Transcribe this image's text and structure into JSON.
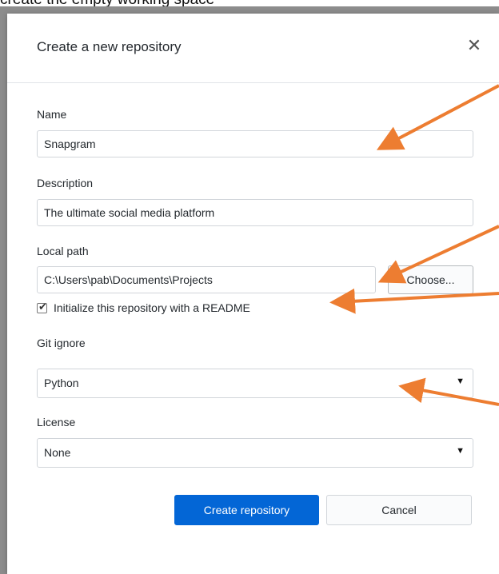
{
  "caption": "create the empty working space",
  "dialog": {
    "title": "Create a new repository",
    "close_icon": "close-icon"
  },
  "fields": {
    "name": {
      "label": "Name",
      "value": "Snapgram"
    },
    "description": {
      "label": "Description",
      "value": "The ultimate social media platform"
    },
    "local_path": {
      "label": "Local path",
      "value": "C:\\Users\\pab\\Documents\\Projects",
      "choose_label": "Choose..."
    },
    "readme": {
      "label": "Initialize this repository with a README",
      "checked": true
    },
    "git_ignore": {
      "label": "Git ignore",
      "selected": "Python"
    },
    "license": {
      "label": "License",
      "selected": "None"
    }
  },
  "footer": {
    "create_label": "Create repository",
    "cancel_label": "Cancel"
  },
  "colors": {
    "primary": "#0366d6",
    "annotation_arrow": "#ed7d31",
    "frame": "#8c8c8c"
  },
  "icons": {
    "close": "close-icon",
    "checkbox_tick": "checkmark-icon",
    "dropdown": "triangle-down-icon"
  }
}
